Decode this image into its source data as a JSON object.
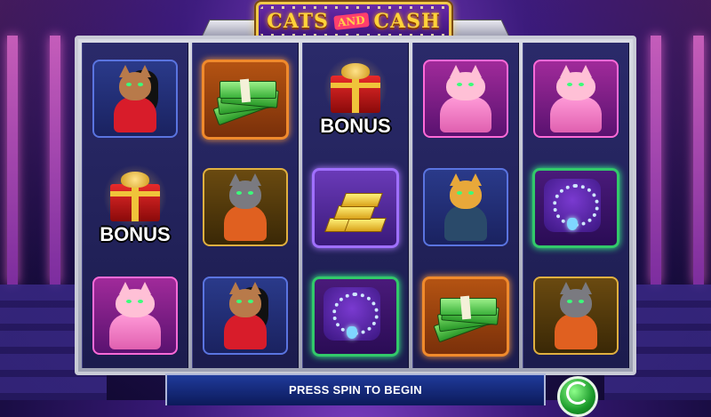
{
  "game": {
    "title_word1": "CATS",
    "title_and": "AND",
    "title_word2": "CASH"
  },
  "reels": [
    [
      {
        "symbol": "female-cat"
      },
      {
        "symbol": "bonus-gift",
        "label": "BONUS"
      },
      {
        "symbol": "fluffy-pink-cat"
      }
    ],
    [
      {
        "symbol": "cash-stack"
      },
      {
        "symbol": "boss-cat"
      },
      {
        "symbol": "female-cat"
      }
    ],
    [
      {
        "symbol": "bonus-gift",
        "label": "BONUS"
      },
      {
        "symbol": "gold-bars"
      },
      {
        "symbol": "diamond-necklace"
      }
    ],
    [
      {
        "symbol": "fluffy-pink-cat"
      },
      {
        "symbol": "ginger-cat"
      },
      {
        "symbol": "cash-stack"
      }
    ],
    [
      {
        "symbol": "fluffy-pink-cat"
      },
      {
        "symbol": "diamond-necklace"
      },
      {
        "symbol": "boss-cat"
      }
    ]
  ],
  "status": {
    "message": "PRESS SPIN TO BEGIN"
  },
  "controls": {
    "spin_icon": "spin-arrow-icon"
  }
}
